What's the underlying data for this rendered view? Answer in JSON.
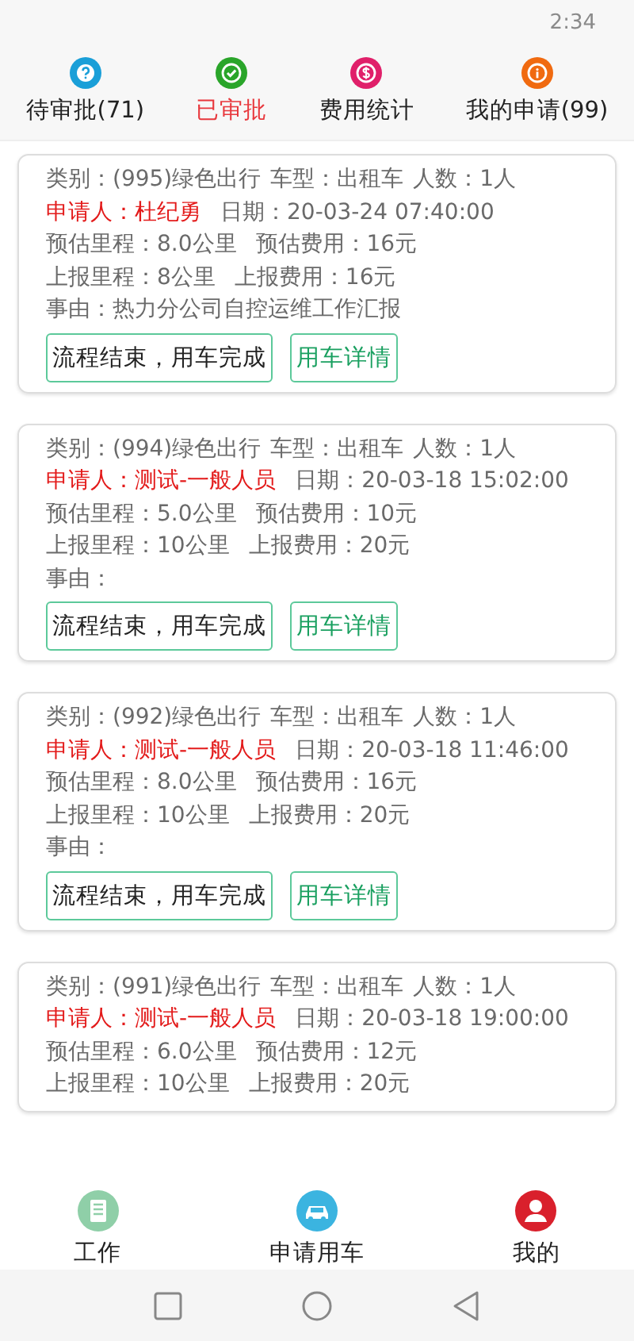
{
  "status_bar": {
    "time": "2:34"
  },
  "tabs": [
    {
      "label": "待审批(71)",
      "selected": false,
      "color": "#1a9fd8",
      "kind": "question"
    },
    {
      "label": "已审批",
      "selected": true,
      "color": "#2aa52a",
      "kind": "check"
    },
    {
      "label": "费用统计",
      "selected": false,
      "color": "#e0206a",
      "kind": "dollar"
    },
    {
      "label": "我的申请(99)",
      "selected": false,
      "color": "#f06a10",
      "kind": "info"
    }
  ],
  "cards": [
    {
      "category": "类别：(995)绿色出行",
      "car_type": "车型：出租车",
      "people": "人数：1人",
      "applicant": "申请人：杜纪勇",
      "date": "日期：20-03-24 07:40:00",
      "est_distance": "预估里程：8.0公里",
      "est_cost": "预估费用：16元",
      "reported_distance": "上报里程：8公里",
      "reported_cost": "上报费用：16元",
      "reason": "事由：热力分公司自控运维工作汇报",
      "buttons": [
        "流程结束，用车完成",
        "用车详情"
      ]
    },
    {
      "category": "类别：(994)绿色出行",
      "car_type": "车型：出租车",
      "people": "人数：1人",
      "applicant": "申请人：测试-一般人员",
      "date": "日期：20-03-18 15:02:00",
      "est_distance": "预估里程：5.0公里",
      "est_cost": "预估费用：10元",
      "reported_distance": "上报里程：10公里",
      "reported_cost": "上报费用：20元",
      "reason": "事由：",
      "buttons": [
        "流程结束，用车完成",
        "用车详情"
      ]
    },
    {
      "category": "类别：(992)绿色出行",
      "car_type": "车型：出租车",
      "people": "人数：1人",
      "applicant": "申请人：测试-一般人员",
      "date": "日期：20-03-18 11:46:00",
      "est_distance": "预估里程：8.0公里",
      "est_cost": "预估费用：16元",
      "reported_distance": "上报里程：10公里",
      "reported_cost": "上报费用：20元",
      "reason": "事由：",
      "buttons": [
        "流程结束，用车完成",
        "用车详情"
      ]
    },
    {
      "category": "类别：(991)绿色出行",
      "car_type": "车型：出租车",
      "people": "人数：1人",
      "applicant": "申请人：测试-一般人员",
      "date": "日期：20-03-18 19:00:00",
      "est_distance": "预估里程：6.0公里",
      "est_cost": "预估费用：12元",
      "reported_distance": "上报里程：10公里",
      "reported_cost": "上报费用：20元"
    }
  ],
  "bottom_nav": [
    {
      "label": "工作",
      "kind": "list",
      "color": "#8fcfa8"
    },
    {
      "label": "申请用车",
      "kind": "car",
      "color": "#3bb4e0"
    },
    {
      "label": "我的",
      "kind": "person",
      "color": "#d9202c"
    }
  ]
}
